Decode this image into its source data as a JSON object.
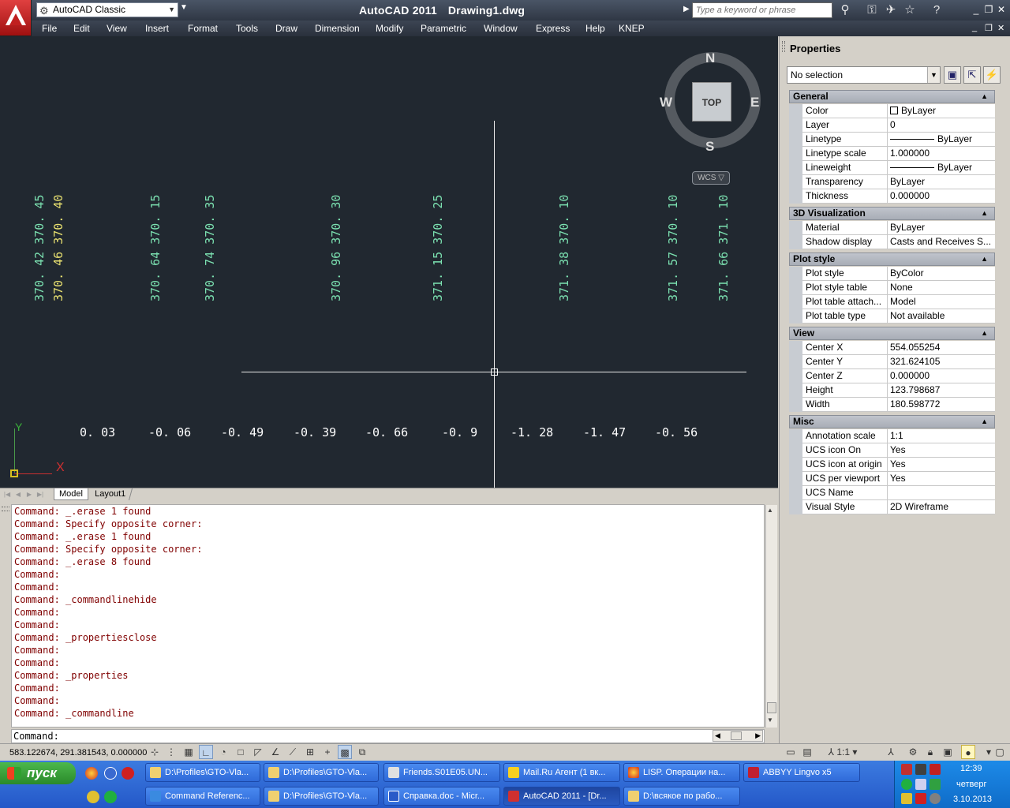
{
  "title_bar": {
    "workspace": "AutoCAD Classic",
    "app_name": "AutoCAD 2011",
    "document": "Drawing1.dwg",
    "search_placeholder": "Type a keyword or phrase"
  },
  "menu": [
    "File",
    "Edit",
    "View",
    "Insert",
    "Format",
    "Tools",
    "Draw",
    "Dimension",
    "Modify",
    "Parametric",
    "Window",
    "Express",
    "Help",
    "KNEP"
  ],
  "drawing": {
    "vertical_annotations": [
      {
        "text": "370. 42  370. 45",
        "color": "green"
      },
      {
        "text": "370. 46  370. 40",
        "color": "yellow"
      },
      {
        "text": "370. 64  370. 15",
        "color": "green"
      },
      {
        "text": "370. 74  370. 35",
        "color": "green"
      },
      {
        "text": "370. 96  370. 30",
        "color": "green"
      },
      {
        "text": "371. 15  370. 25",
        "color": "green"
      },
      {
        "text": "371. 38  370. 10",
        "color": "green"
      },
      {
        "text": "371. 57  370. 10",
        "color": "green"
      },
      {
        "text": "371. 66  371. 10",
        "color": "green"
      }
    ],
    "differences": [
      "0. 03",
      "-0. 06",
      "-0. 49",
      "-0. 39",
      "-0. 66",
      "-0. 9",
      "-1. 28",
      "-1. 47",
      "-0. 56"
    ],
    "viewcube": {
      "top": "TOP",
      "north": "N",
      "south": "S",
      "east": "E",
      "west": "W",
      "wcs": "WCS"
    },
    "ucs": {
      "x": "X",
      "y": "Y"
    }
  },
  "tabs": {
    "model": "Model",
    "layout1": "Layout1"
  },
  "command_history": [
    "Command: _.erase 1 found",
    "Command: Specify opposite corner:",
    "Command: _.erase 1 found",
    "Command: Specify opposite corner:",
    "Command: _.erase 8 found",
    "Command:",
    "Command:",
    "Command: _commandlinehide",
    "Command:",
    "Command:",
    "Command: _propertiesclose",
    "Command:",
    "Command:",
    "Command: _properties",
    "Command:",
    "Command:",
    "Command: _commandline"
  ],
  "command_prompt": "Command:",
  "status": {
    "coords": "583.122674, 291.381543, 0.000000",
    "annotation_scale": "1:1"
  },
  "properties": {
    "title": "Properties",
    "selection": "No selection",
    "sections": [
      {
        "name": "General",
        "rows": [
          {
            "k": "Color",
            "v": "ByLayer"
          },
          {
            "k": "Layer",
            "v": "0"
          },
          {
            "k": "Linetype",
            "v": "ByLayer"
          },
          {
            "k": "Linetype scale",
            "v": "1.000000"
          },
          {
            "k": "Lineweight",
            "v": "ByLayer"
          },
          {
            "k": "Transparency",
            "v": "ByLayer"
          },
          {
            "k": "Thickness",
            "v": "0.000000"
          }
        ]
      },
      {
        "name": "3D Visualization",
        "rows": [
          {
            "k": "Material",
            "v": "ByLayer"
          },
          {
            "k": "Shadow display",
            "v": "Casts and Receives S..."
          }
        ]
      },
      {
        "name": "Plot style",
        "rows": [
          {
            "k": "Plot style",
            "v": "ByColor"
          },
          {
            "k": "Plot style table",
            "v": "None"
          },
          {
            "k": "Plot table attach...",
            "v": "Model"
          },
          {
            "k": "Plot table type",
            "v": "Not available"
          }
        ]
      },
      {
        "name": "View",
        "rows": [
          {
            "k": "Center X",
            "v": "554.055254"
          },
          {
            "k": "Center Y",
            "v": "321.624105"
          },
          {
            "k": "Center Z",
            "v": "0.000000"
          },
          {
            "k": "Height",
            "v": "123.798687"
          },
          {
            "k": "Width",
            "v": "180.598772"
          }
        ]
      },
      {
        "name": "Misc",
        "rows": [
          {
            "k": "Annotation scale",
            "v": "1:1"
          },
          {
            "k": "UCS icon On",
            "v": "Yes"
          },
          {
            "k": "UCS icon at origin",
            "v": "Yes"
          },
          {
            "k": "UCS per viewport",
            "v": "Yes"
          },
          {
            "k": "UCS Name",
            "v": ""
          },
          {
            "k": "Visual Style",
            "v": "2D Wireframe"
          }
        ]
      }
    ]
  },
  "taskbar": {
    "start": "пуск",
    "row1": [
      "D:\\Profiles\\GTO-Vla...",
      "D:\\Profiles\\GTO-Vla...",
      "Friends.S01E05.UN...",
      "Mail.Ru Агент (1 вк...",
      "LISP. Операции на...",
      "ABBYY Lingvo x5"
    ],
    "row2": [
      "Command Referenc...",
      "D:\\Profiles\\GTO-Vla...",
      "Справка.doc - Micr...",
      "AutoCAD 2011 - [Dr...",
      "D:\\всякое по рабо..."
    ],
    "clock": {
      "time": "12:39",
      "day": "четверг",
      "date": "3.10.2013"
    }
  }
}
